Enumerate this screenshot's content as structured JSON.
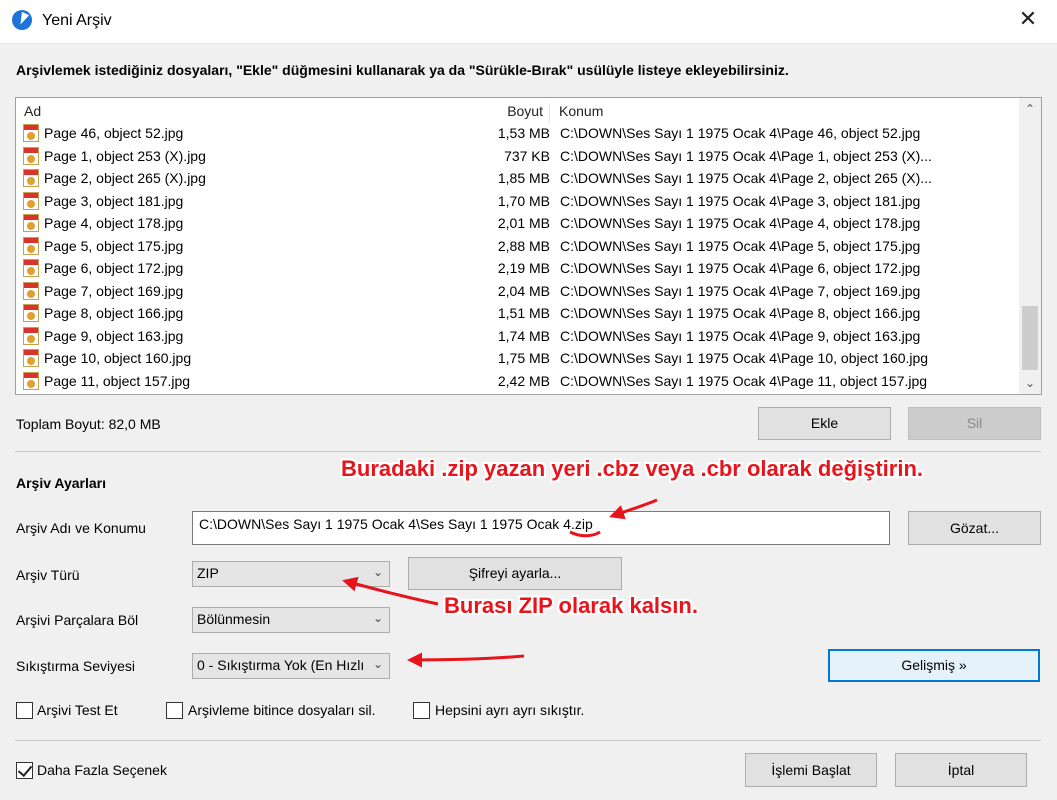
{
  "window": {
    "title": "Yeni Arşiv",
    "close_glyph": "✕"
  },
  "instruction": "Arşivlemek istediğiniz dosyaları, \"Ekle\" düğmesini kullanarak ya da \"Sürükle-Bırak\" usülüyle listeye ekleyebilirsiniz.",
  "file_list": {
    "columns": {
      "name": "Ad",
      "size": "Boyut",
      "location": "Konum"
    },
    "rows": [
      {
        "name": "Page 46, object 52.jpg",
        "size": "1,53 MB",
        "location": "C:\\DOWN\\Ses Sayı 1 1975 Ocak 4\\Page 46, object 52.jpg"
      },
      {
        "name": "Page 1, object 253 (X).jpg",
        "size": "737 KB",
        "location": "C:\\DOWN\\Ses Sayı 1 1975 Ocak 4\\Page 1, object 253 (X)..."
      },
      {
        "name": "Page 2, object 265 (X).jpg",
        "size": "1,85 MB",
        "location": "C:\\DOWN\\Ses Sayı 1 1975 Ocak 4\\Page 2, object 265 (X)..."
      },
      {
        "name": "Page 3, object 181.jpg",
        "size": "1,70 MB",
        "location": "C:\\DOWN\\Ses Sayı 1 1975 Ocak 4\\Page 3, object 181.jpg"
      },
      {
        "name": "Page 4, object 178.jpg",
        "size": "2,01 MB",
        "location": "C:\\DOWN\\Ses Sayı 1 1975 Ocak 4\\Page 4, object 178.jpg"
      },
      {
        "name": "Page 5, object 175.jpg",
        "size": "2,88 MB",
        "location": "C:\\DOWN\\Ses Sayı 1 1975 Ocak 4\\Page 5, object 175.jpg"
      },
      {
        "name": "Page 6, object 172.jpg",
        "size": "2,19 MB",
        "location": "C:\\DOWN\\Ses Sayı 1 1975 Ocak 4\\Page 6, object 172.jpg"
      },
      {
        "name": "Page 7, object 169.jpg",
        "size": "2,04 MB",
        "location": "C:\\DOWN\\Ses Sayı 1 1975 Ocak 4\\Page 7, object 169.jpg"
      },
      {
        "name": "Page 8, object 166.jpg",
        "size": "1,51 MB",
        "location": "C:\\DOWN\\Ses Sayı 1 1975 Ocak 4\\Page 8, object 166.jpg"
      },
      {
        "name": "Page 9, object 163.jpg",
        "size": "1,74 MB",
        "location": "C:\\DOWN\\Ses Sayı 1 1975 Ocak 4\\Page 9, object 163.jpg"
      },
      {
        "name": "Page 10, object 160.jpg",
        "size": "1,75 MB",
        "location": "C:\\DOWN\\Ses Sayı 1 1975 Ocak 4\\Page 10, object 160.jpg"
      },
      {
        "name": "Page 11, object 157.jpg",
        "size": "2,42 MB",
        "location": "C:\\DOWN\\Ses Sayı 1 1975 Ocak 4\\Page 11, object 157.jpg"
      }
    ],
    "scroll_up_glyph": "⌃",
    "scroll_down_glyph": "⌄"
  },
  "total_size": "Toplam Boyut: 82,0 MB",
  "buttons": {
    "add": "Ekle",
    "delete": "Sil",
    "browse": "Gözat...",
    "set_password": "Şifreyi ayarla...",
    "advanced": "Gelişmiş »",
    "start": "İşlemi Başlat",
    "cancel": "İptal"
  },
  "settings": {
    "section_title": "Arşiv Ayarları",
    "name_label": "Arşiv Adı ve Konumu",
    "name_value": "C:\\DOWN\\Ses Sayı 1 1975 Ocak 4\\Ses Sayı 1 1975 Ocak 4.zip",
    "type_label": "Arşiv Türü",
    "type_value": "ZIP",
    "split_label": "Arşivi Parçalara Böl",
    "split_value": "Bölünmesin",
    "compression_label": "Sıkıştırma Seviyesi",
    "compression_value": "0 - Sıkıştırma Yok (En Hızlı",
    "caret_glyph": "⌄"
  },
  "checkboxes": {
    "test": {
      "label": "Arşivi Test Et",
      "checked": false
    },
    "delete_after": {
      "label": "Arşivleme bitince dosyaları sil.",
      "checked": false
    },
    "separate": {
      "label": "Hepsini ayrı ayrı sıkıştır.",
      "checked": false
    },
    "more_options": {
      "label": "Daha Fazla Seçenek",
      "checked": true
    }
  },
  "annotations": {
    "top": "Buradaki .zip yazan yeri .cbz veya .cbr olarak değiştirin.",
    "middle": "Burası ZIP olarak kalsın.",
    "color": "#e8141c"
  },
  "icons": {
    "app": "app-logo-icon",
    "file": "jpg-file-icon"
  }
}
